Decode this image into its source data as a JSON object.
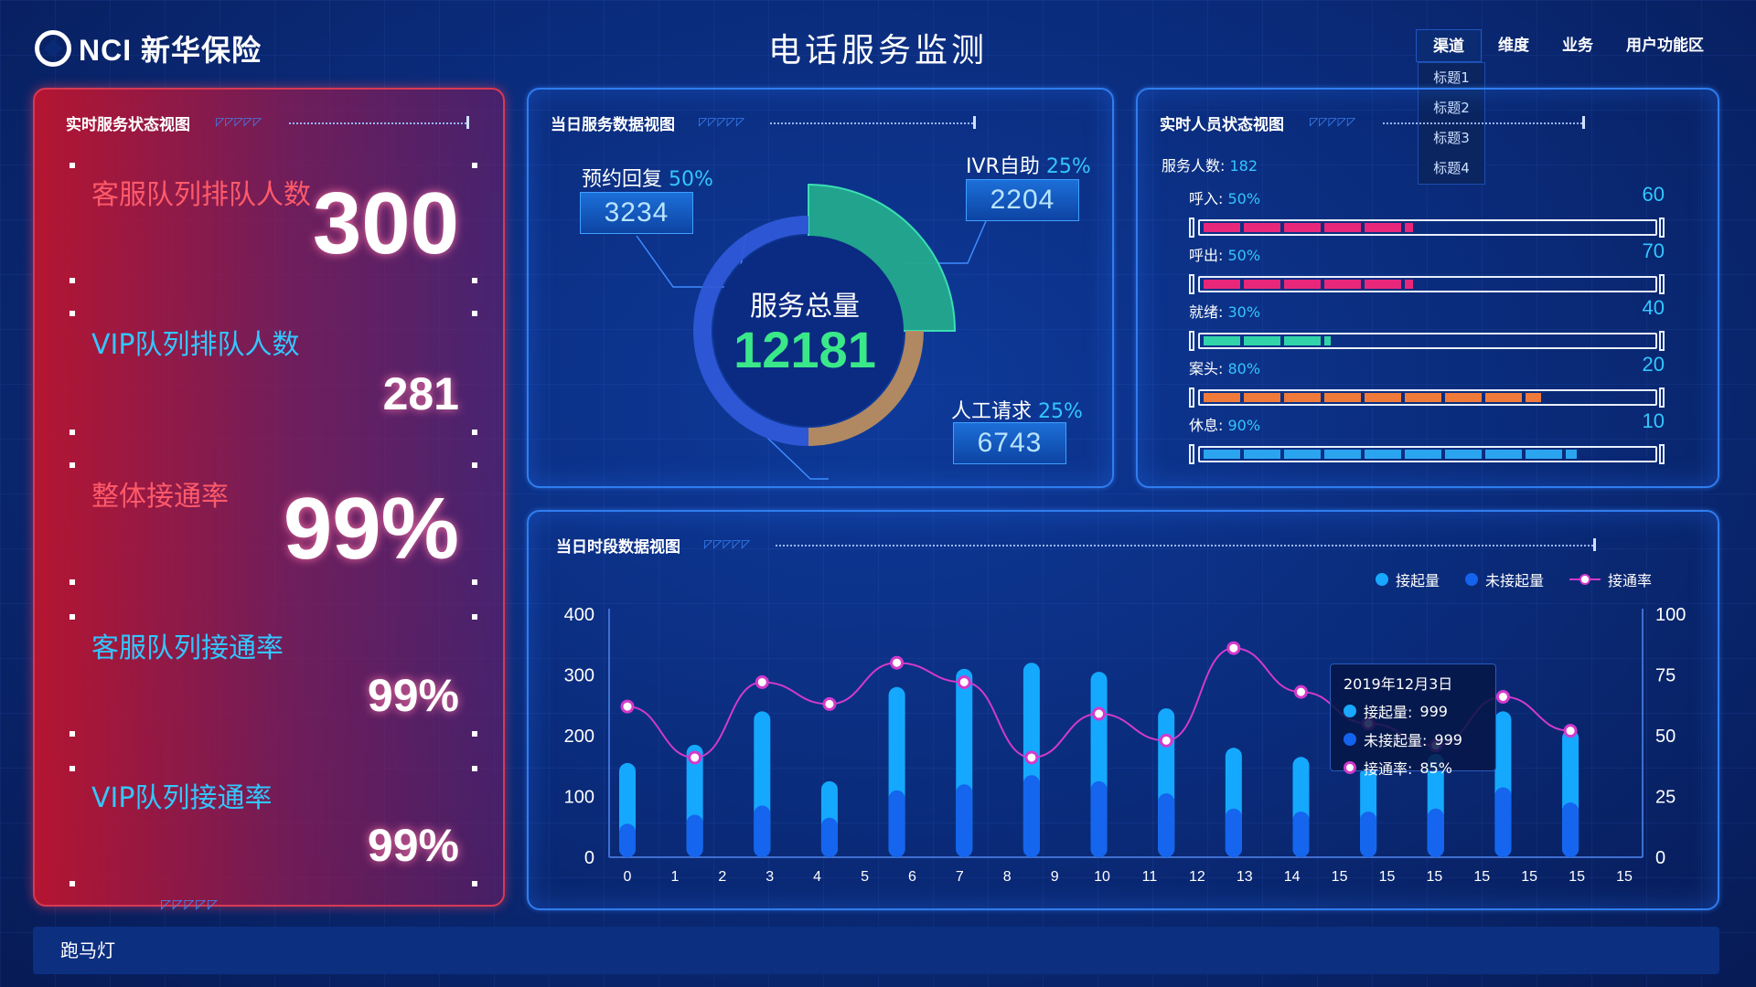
{
  "header": {
    "logo_text": "NCI 新华保险",
    "title": "电话服务监测",
    "menu": [
      {
        "label": "渠道"
      },
      {
        "label": "维度"
      },
      {
        "label": "业务"
      },
      {
        "label": "用户功能区"
      }
    ],
    "dropdown": [
      "标题1",
      "标题2",
      "标题3",
      "标题4"
    ]
  },
  "status_panel": {
    "title": "实时服务状态视图",
    "deco": "◸◸◸◸◸",
    "items": [
      {
        "label": "客服队列排队人数",
        "value": "300"
      },
      {
        "label": "VIP队列排队人数",
        "value": "281"
      },
      {
        "label": "整体接通率",
        "value": "99%"
      },
      {
        "label": "客服队列接通率",
        "value": "99%"
      },
      {
        "label": "VIP队列接通率",
        "value": "99%"
      }
    ],
    "corner": "◸◸◸◸◸"
  },
  "service_panel": {
    "title": "当日服务数据视图",
    "deco": "◸◸◸◸◸",
    "center_label": "服务总量",
    "center_value": "12181",
    "segments": [
      {
        "name": "预约回复",
        "pct": "50%",
        "value": "3234",
        "fraction": 0.5,
        "color": "#2f58d8"
      },
      {
        "name": "IVR自助",
        "pct": "25%",
        "value": "2204",
        "fraction": 0.25,
        "color": "#23a98e"
      },
      {
        "name": "人工请求",
        "pct": "25%",
        "value": "6743",
        "fraction": 0.25,
        "color": "#b98c5e"
      }
    ]
  },
  "staff_panel": {
    "title": "实时人员状态视图",
    "deco": "◸◸◸◸◸",
    "service_count_label": "服务人数:",
    "service_count": "182",
    "rows": [
      {
        "label": "呼入:",
        "pct": "50%",
        "count": "60",
        "fill": 0.46,
        "color": "#e8277a"
      },
      {
        "label": "呼出:",
        "pct": "50%",
        "count": "70",
        "fill": 0.46,
        "color": "#e8277a"
      },
      {
        "label": "就绪:",
        "pct": "30%",
        "count": "40",
        "fill": 0.28,
        "color": "#2fd5a8"
      },
      {
        "label": "案头:",
        "pct": "80%",
        "count": "20",
        "fill": 0.74,
        "color": "#f07a3a"
      },
      {
        "label": "休息:",
        "pct": "90%",
        "count": "10",
        "fill": 0.82,
        "color": "#2ba4f0"
      }
    ]
  },
  "chart_panel": {
    "title": "当日时段数据视图",
    "deco": "◸◸◸◸◸",
    "legend": [
      {
        "name": "接起量",
        "color": "#18a8ff"
      },
      {
        "name": "未接起量",
        "color": "#1463ee"
      },
      {
        "name": "接通率",
        "color": "#d23acb"
      }
    ],
    "tooltip": {
      "date": "2019年12月3日",
      "rows": [
        {
          "label": "接起量:",
          "value": "999",
          "color": "#18a8ff"
        },
        {
          "label": "未接起量:",
          "value": "999",
          "color": "#1463ee"
        },
        {
          "label": "接通率:",
          "value": "85%",
          "color": "#ffffff"
        }
      ]
    }
  },
  "chart_data": {
    "type": "bar",
    "categories": [
      "0",
      "1",
      "2",
      "3",
      "4",
      "5",
      "6",
      "7",
      "8",
      "9",
      "10",
      "11",
      "12",
      "13",
      "14",
      "15",
      "15",
      "15",
      "15",
      "15",
      "15",
      "15"
    ],
    "y_left": {
      "ticks": [
        "400",
        "300",
        "200",
        "100",
        "0"
      ],
      "ylim": [
        0,
        400
      ]
    },
    "y_right": {
      "ticks": [
        "100",
        "75",
        "50",
        "25",
        "0"
      ],
      "ylim": [
        0,
        100
      ]
    },
    "series": [
      {
        "name": "接起量",
        "values": [
          155,
          185,
          240,
          125,
          280,
          310,
          320,
          305,
          245,
          180,
          165,
          150,
          170,
          240,
          210
        ]
      },
      {
        "name": "未接起量",
        "values": [
          55,
          70,
          85,
          65,
          110,
          120,
          135,
          125,
          105,
          80,
          75,
          75,
          80,
          115,
          90
        ]
      },
      {
        "name": "接通率",
        "values": [
          62,
          41,
          72,
          63,
          80,
          72,
          41,
          59,
          48,
          86,
          68,
          55,
          46,
          66,
          52
        ]
      }
    ]
  },
  "ticker": {
    "text": "跑马灯"
  }
}
